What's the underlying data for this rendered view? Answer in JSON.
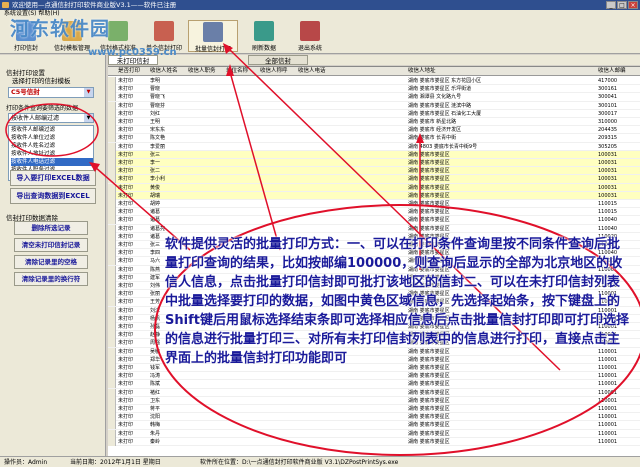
{
  "window": {
    "title": "欢迎使用—点通信封打印软件商业版V3.1——软件已注册"
  },
  "menubar": {
    "items": "系统设置(S)  帮助(H)"
  },
  "toolbar": {
    "items": [
      {
        "label": "打印信封"
      },
      {
        "label": "信封模板管理"
      },
      {
        "label": "信封格式校准"
      },
      {
        "label": "单个信封打印"
      },
      {
        "label": "批量信封打印"
      },
      {
        "label": "刷新数据"
      },
      {
        "label": "退出系统"
      }
    ]
  },
  "left": {
    "group1": "信封打印设置",
    "envelope_label": "选择打印的信封模板",
    "envelope_value": "C5号信封",
    "group2": "打印条件查询要筛选的数据",
    "filter_value": "按收件人邮编过滤",
    "filter_list": [
      "按收件人邮编过滤",
      "按收件人单位过滤",
      "按收件人姓名过滤",
      "按收件人地址过滤",
      "按收件人电话过滤",
      "按收件人职务过滤"
    ],
    "import_btn": "导入要打印EXCEL数据",
    "export_btn": "导出查询数据到EXCEL",
    "group3": "信封打印数据清除",
    "btn_del_sel": "删除所选记录",
    "btn_clear_printed": "清空未打印信封记录",
    "btn_clear_blank": "清除记录里的空格",
    "btn_clear_lines": "清除记录里的换行符"
  },
  "tabs": {
    "unprinted": "未打印信封",
    "all": "全部信封"
  },
  "grid": {
    "headers": [
      "是否打印",
      "收信人姓名",
      "收信人职务",
      "单位名称",
      "收信人称呼",
      "收信人电话",
      "收信人地址",
      "收信人邮编"
    ],
    "rows": [
      {
        "status": "未打印",
        "name": "李明",
        "addr": "湖南 娄底市娄星区 东方花园小区",
        "zip": "417000",
        "yellow": false
      },
      {
        "status": "未打印",
        "name": "曹晓",
        "addr": "湖南 娄底市娄星区 乐坪街道",
        "zip": "300161",
        "yellow": false
      },
      {
        "status": "未打印",
        "name": "曹晓飞",
        "addr": "湖南 湘潭县 文化路九号",
        "zip": "300041",
        "yellow": false
      },
      {
        "status": "未打印",
        "name": "曹晓芬",
        "addr": "湖南 娄底市娄星区 涟滨中路",
        "zip": "300101",
        "yellow": false
      },
      {
        "status": "未打印",
        "name": "刘红",
        "addr": "湖南 娄底市娄星区 石油化工大厦",
        "zip": "300017",
        "yellow": false
      },
      {
        "status": "未打印",
        "name": "王明",
        "addr": "湖南 娄底市 新星北路",
        "zip": "310000",
        "yellow": false
      },
      {
        "status": "未打印",
        "name": "宋东东",
        "addr": "湖南 娄底市 经济开发区",
        "zip": "204435",
        "yellow": false
      },
      {
        "status": "未打印",
        "name": "陈文艳",
        "addr": "湖南 娄底市 长青中街",
        "zip": "209315",
        "yellow": false
      },
      {
        "status": "未打印",
        "name": "李爱丽",
        "addr": "湖南 4803 娄底市长青中街9号",
        "zip": "305205",
        "yellow": false
      },
      {
        "status": "未打印",
        "name": "张三",
        "addr": "湖南 娄底市娄星区",
        "zip": "100031",
        "yellow": true
      },
      {
        "status": "未打印",
        "name": "李一",
        "addr": "湖南 娄底市娄星区",
        "zip": "100031",
        "yellow": true
      },
      {
        "status": "未打印",
        "name": "张二",
        "addr": "湖南 娄底市娄星区",
        "zip": "100031",
        "yellow": true
      },
      {
        "status": "未打印",
        "name": "李小利",
        "addr": "湖南 娄底市娄星区",
        "zip": "100031",
        "yellow": true
      },
      {
        "status": "未打印",
        "name": "黄俊",
        "addr": "湖南 娄底市娄星区",
        "zip": "100031",
        "yellow": true
      },
      {
        "status": "未打印",
        "name": "胡瑞",
        "addr": "湖南 娄底市娄星区",
        "zip": "100031",
        "yellow": true
      },
      {
        "status": "未打印",
        "name": "胡婷",
        "addr": "湖南 娄底市娄星区",
        "zip": "110015",
        "yellow": false
      },
      {
        "status": "未打印",
        "name": "诸葛",
        "addr": "湖南 娄底市娄星区",
        "zip": "110015",
        "yellow": false
      },
      {
        "status": "未打印",
        "name": "诸葛",
        "addr": "湖南 娄底市娄星区",
        "zip": "110040",
        "yellow": false
      },
      {
        "status": "未打印",
        "name": "诸葛亮",
        "addr": "湖南 娄底市娄星区",
        "zip": "110040",
        "yellow": false
      },
      {
        "status": "未打印",
        "name": "诸葛",
        "addr": "湖南 娄底市娄星区",
        "zip": "110020",
        "yellow": false
      },
      {
        "status": "未打印",
        "name": "张三",
        "addr": "湖南 娄底市娄星区",
        "zip": "110025",
        "yellow": false
      },
      {
        "status": "未打印",
        "name": "李四",
        "addr": "湖南 娄底市娄星区",
        "zip": "110040",
        "yellow": false
      },
      {
        "status": "未打印",
        "name": "马六",
        "addr": "湖南 娄底市娄星区",
        "zip": "110001",
        "yellow": false
      },
      {
        "status": "未打印",
        "name": "陈燕",
        "addr": "湖南 娄底市娄星区",
        "zip": "110001",
        "yellow": false
      },
      {
        "status": "未打印",
        "name": "建军",
        "addr": "湖南 娄底市娄星区",
        "zip": "110001",
        "yellow": false
      },
      {
        "status": "未打印",
        "name": "刘伟",
        "addr": "湖南 娄底市娄星区",
        "zip": "110001",
        "yellow": false
      },
      {
        "status": "未打印",
        "name": "张丽",
        "addr": "湖南 娄底市娄星区",
        "zip": "110001",
        "yellow": false
      },
      {
        "status": "未打印",
        "name": "王芳",
        "addr": "湖南 娄底市娄星区",
        "zip": "110001",
        "yellow": false
      },
      {
        "status": "未打印",
        "name": "刘洋",
        "addr": "湖南 娄底市娄星区",
        "zip": "110001",
        "yellow": false
      },
      {
        "status": "未打印",
        "name": "杨帆",
        "addr": "湖南 娄底市娄星区",
        "zip": "110001",
        "yellow": false
      },
      {
        "status": "未打印",
        "name": "孙磊",
        "addr": "湖南 娄底市娄星区",
        "zip": "110001",
        "yellow": false
      },
      {
        "status": "未打印",
        "name": "赵静",
        "addr": "湖南 娄底市娄星区",
        "zip": "110001",
        "yellow": false
      },
      {
        "status": "未打印",
        "name": "周强",
        "addr": "湖南 娄底市娄星区",
        "zip": "110001",
        "yellow": false
      },
      {
        "status": "未打印",
        "name": "吴敏",
        "addr": "湖南 娄底市娄星区",
        "zip": "110001",
        "yellow": false
      },
      {
        "status": "未打印",
        "name": "郑华",
        "addr": "湖南 娄底市娄星区",
        "zip": "110001",
        "yellow": false
      },
      {
        "status": "未打印",
        "name": "钱军",
        "addr": "湖南 娄底市娄星区",
        "zip": "110001",
        "yellow": false
      },
      {
        "status": "未打印",
        "name": "冯涛",
        "addr": "湖南 娄底市娄星区",
        "zip": "110001",
        "yellow": false
      },
      {
        "status": "未打印",
        "name": "陈斌",
        "addr": "湖南 娄底市娄星区",
        "zip": "110001",
        "yellow": false
      },
      {
        "status": "未打印",
        "name": "褚红",
        "addr": "湖南 娄底市娄星区",
        "zip": "110001",
        "yellow": false
      },
      {
        "status": "未打印",
        "name": "卫东",
        "addr": "湖南 娄底市娄星区",
        "zip": "110001",
        "yellow": false
      },
      {
        "status": "未打印",
        "name": "蒋平",
        "addr": "湖南 娄底市娄星区",
        "zip": "110001",
        "yellow": false
      },
      {
        "status": "未打印",
        "name": "沈阳",
        "addr": "湖南 娄底市娄星区",
        "zip": "110001",
        "yellow": false
      },
      {
        "status": "未打印",
        "name": "韩梅",
        "addr": "湖南 娄底市娄星区",
        "zip": "110001",
        "yellow": false
      },
      {
        "status": "未打印",
        "name": "朱丹",
        "addr": "湖南 娄底市娄星区",
        "zip": "110001",
        "yellow": false
      },
      {
        "status": "未打印",
        "name": "秦岭",
        "addr": "湖南 娄底市娄星区",
        "zip": "110001",
        "yellow": false
      }
    ]
  },
  "status": {
    "user": "操作员：Admin",
    "date": "当前日期：2012年1月1日 星期日",
    "path": "软件所在位置：D:\\一点通信封打印软件商业版 V3.1\\DZPostPrintSys.exe"
  },
  "watermark": {
    "text": "河东软件园",
    "url": "www.pc0359.cn"
  },
  "annotation": {
    "text": "软件提供灵活的批量打印方式：一、可以在打印条件查询里按不同条件查询后批量打印查询的结果，比如按邮编100000，则查询后显示的全部为北京地区的收信人信息，点击批量打印信封即可批打该地区的信封二、可以在未打印信封列表中批量选择要打印的数据，如图中黄色区域信息，先选择起始条，按下键盘上的Shift键后用鼠标选择结束条即可选择相应信息后点击批量信封打印即可打印选择的信息进行批量打印三、对所有未打印信封列表中的信息进行打印，直接点击主界面上的批量信封打印功能即可"
  },
  "colors": {
    "annotation": "#e0102a",
    "annotation_text": "#1a1a9a",
    "highlight_row": "#ffffc0",
    "selected_filter": "#316ac5"
  }
}
